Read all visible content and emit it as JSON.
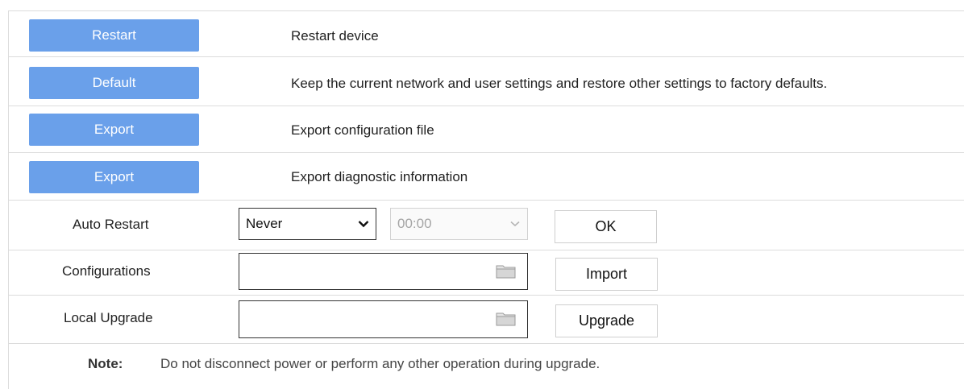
{
  "actions": [
    {
      "button": "Restart",
      "description": "Restart device"
    },
    {
      "button": "Default",
      "description": "Keep the current network and user settings and restore other settings to factory defaults."
    },
    {
      "button": "Export",
      "description": "Export configuration file"
    },
    {
      "button": "Export",
      "description": "Export diagnostic information"
    }
  ],
  "auto_restart": {
    "label": "Auto Restart",
    "frequency_value": "Never",
    "time_value": "00:00",
    "ok_label": "OK"
  },
  "configurations": {
    "label": "Configurations",
    "file_value": "",
    "button_label": "Import"
  },
  "local_upgrade": {
    "label": "Local Upgrade",
    "file_value": "",
    "button_label": "Upgrade"
  },
  "note": {
    "label": "Note:",
    "text": "Do not disconnect power or perform any other operation during upgrade."
  },
  "colors": {
    "primary_button": "#6aa0ea",
    "border": "#dcdcdc"
  },
  "icons": [
    "chevron-down-icon",
    "folder-icon"
  ]
}
